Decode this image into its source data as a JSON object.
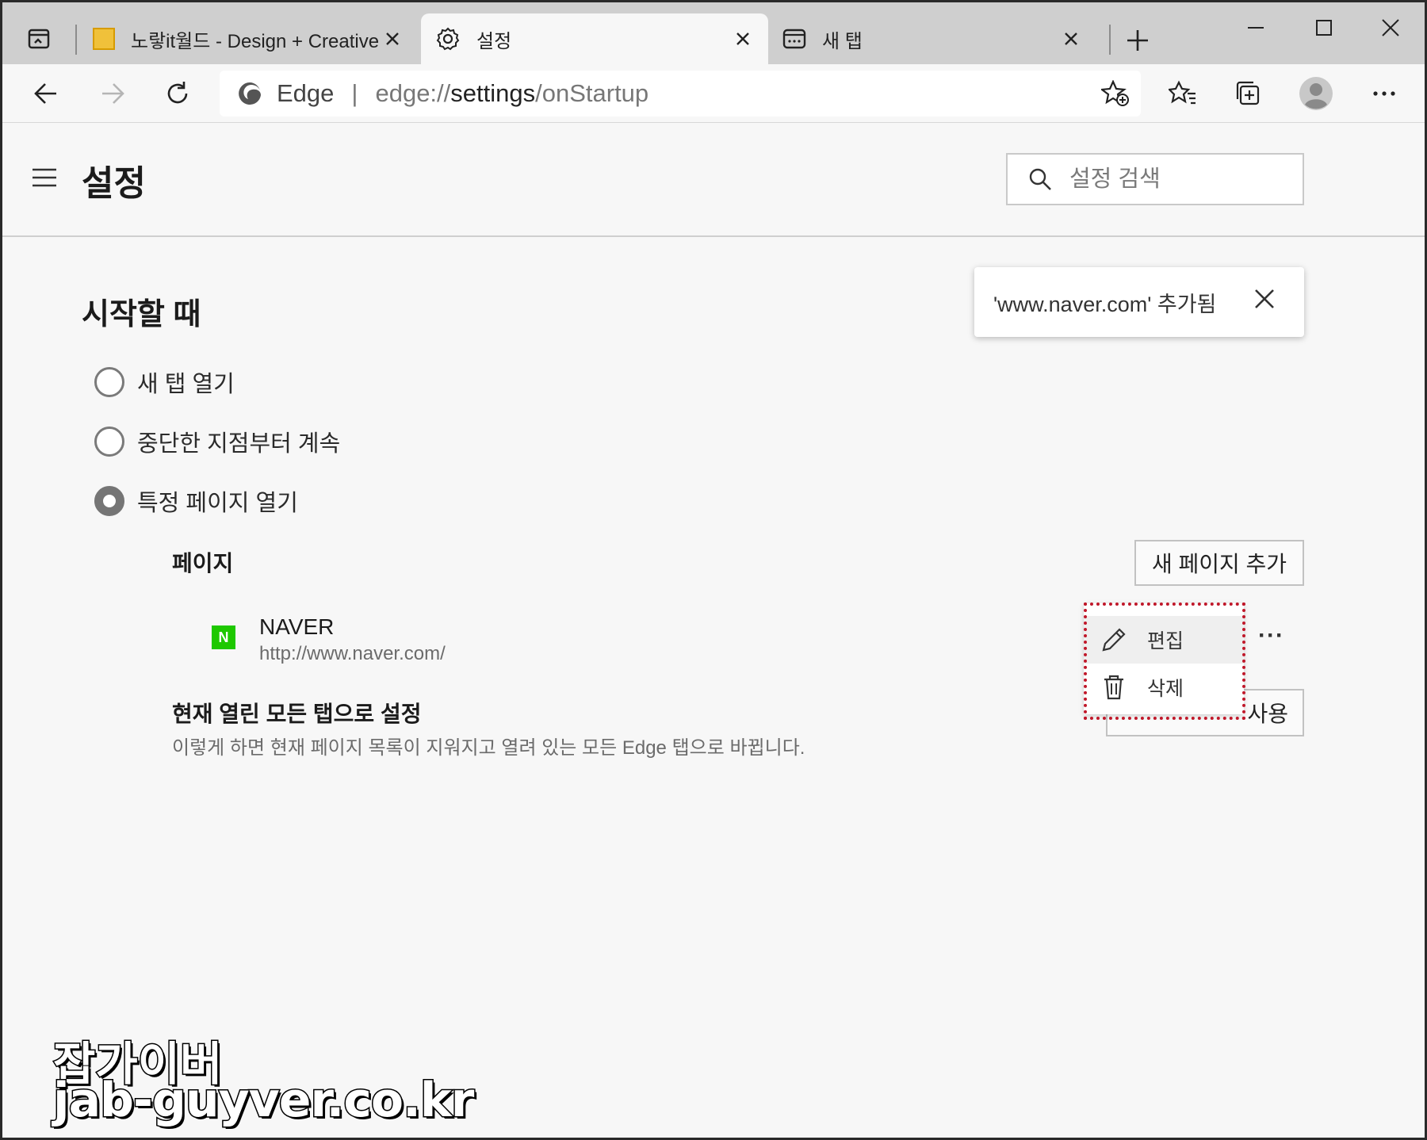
{
  "browser": {
    "tabs": [
      {
        "title": "노랗it월드 - Design + Creative",
        "icon": "site-favicon"
      },
      {
        "title": "설정",
        "icon": "gear-icon",
        "active": true
      },
      {
        "title": "새 탭",
        "icon": "new-tab-icon"
      }
    ],
    "address": {
      "brand": "Edge",
      "separator": "|",
      "url_prefix": "edge://",
      "url_strong": "settings",
      "url_suffix": "/onStartup"
    }
  },
  "settings": {
    "title": "설정",
    "search_placeholder": "설정 검색",
    "section_title": "시작할 때",
    "options": [
      {
        "label": "새 탭 열기",
        "checked": false
      },
      {
        "label": "중단한 지점부터 계속",
        "checked": false
      },
      {
        "label": "특정 페이지 열기",
        "checked": true
      }
    ],
    "pages_label": "페이지",
    "add_page_button": "새 페이지 추가",
    "page_entry": {
      "icon_letter": "N",
      "name": "NAVER",
      "url": "http://www.naver.com/"
    },
    "more_label": "···",
    "set_all_title": "현재 열린 모든 탭으로 설정",
    "set_all_desc": "이렇게 하면 현재 페이지 목록이 지워지고 열려 있는 모든 Edge 탭으로 바뀝니다.",
    "use_button_visible": "사용"
  },
  "toast": {
    "text": "'www.naver.com' 추가됨"
  },
  "context_menu": {
    "items": [
      {
        "label": "편집",
        "icon": "pencil-icon"
      },
      {
        "label": "삭제",
        "icon": "trash-icon"
      }
    ]
  },
  "watermark": {
    "line1": "잡가이버",
    "line2": "jab-guyver.co.kr"
  },
  "colors": {
    "naver_green": "#1ec800",
    "highlight_red": "#c0182a"
  }
}
